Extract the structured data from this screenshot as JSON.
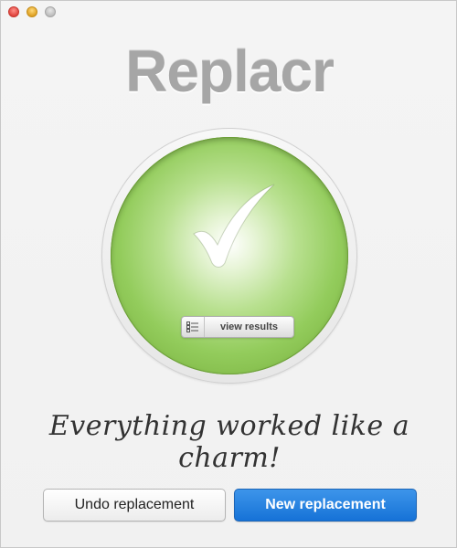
{
  "window": {
    "controls": [
      {
        "name": "close",
        "color": "#e0443e"
      },
      {
        "name": "minimize",
        "color": "#dea123"
      },
      {
        "name": "zoom",
        "color": "#bdbdbd"
      }
    ]
  },
  "app": {
    "title": "Replacr"
  },
  "status": {
    "icon": "checkmark-icon",
    "accent_color": "#8cc652",
    "view_results_label": "view results",
    "view_results_icon": "checklist-icon",
    "message": "Everything worked like a charm!"
  },
  "actions": {
    "undo_label": "Undo replacement",
    "new_label": "New replacement",
    "primary_color": "#1a75d8"
  }
}
